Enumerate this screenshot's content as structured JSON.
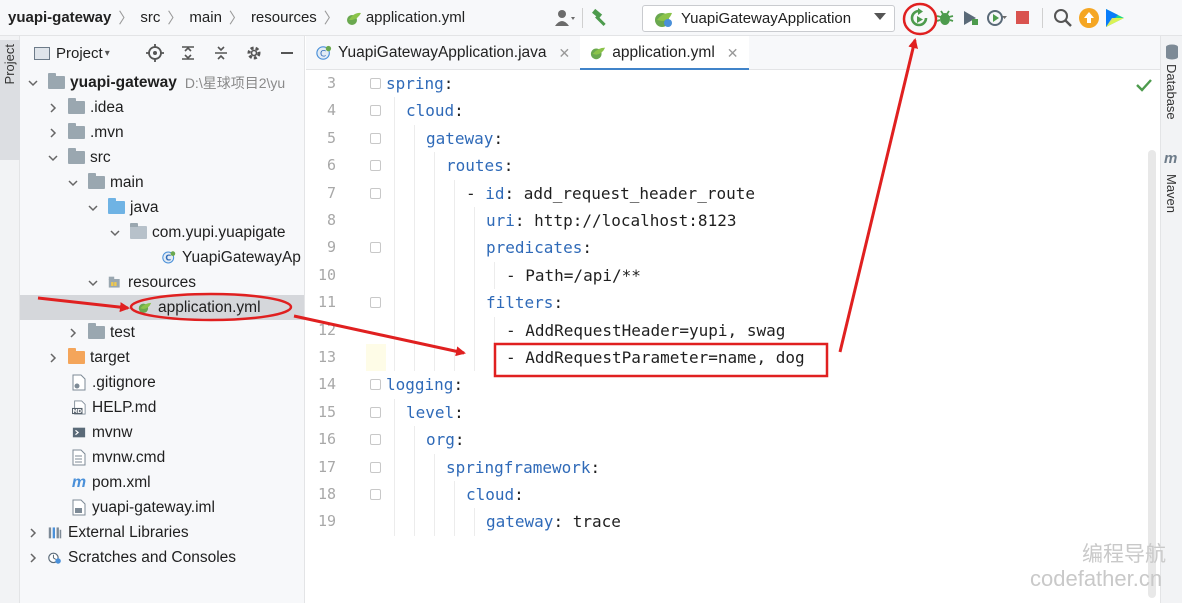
{
  "breadcrumb": {
    "items": [
      "yuapi-gateway",
      "src",
      "main",
      "resources",
      "application.yml"
    ]
  },
  "toolbar": {
    "run_config": "YuapiGatewayApplication",
    "icons": [
      "user-icon",
      "build-hammer-icon",
      "rerun-icon",
      "debug-icon",
      "coverage-icon",
      "profile-icon",
      "stop-icon",
      "search-icon",
      "update-icon",
      "jetbrains-toolbox-icon"
    ]
  },
  "left_stripe": {
    "label": "Project"
  },
  "project_panel": {
    "title": "Project",
    "tree": [
      {
        "label": "yuapi-gateway",
        "extra": "D:\\星球项目2\\yu",
        "type": "module",
        "bold": true
      },
      {
        "label": ".idea",
        "type": "folder"
      },
      {
        "label": ".mvn",
        "type": "folder"
      },
      {
        "label": "src",
        "type": "folder"
      },
      {
        "label": "main",
        "type": "folder"
      },
      {
        "label": "java",
        "type": "folder-blue"
      },
      {
        "label": "com.yupi.yuapigate",
        "type": "package"
      },
      {
        "label": "YuapiGatewayAp",
        "type": "spring-class"
      },
      {
        "label": "resources",
        "type": "resources"
      },
      {
        "label": "application.yml",
        "type": "yml",
        "selected": true
      },
      {
        "label": "test",
        "type": "folder"
      },
      {
        "label": "target",
        "type": "folder-orange"
      },
      {
        "label": ".gitignore",
        "type": "file"
      },
      {
        "label": "HELP.md",
        "type": "md"
      },
      {
        "label": "mvnw",
        "type": "file"
      },
      {
        "label": "mvnw.cmd",
        "type": "file"
      },
      {
        "label": "pom.xml",
        "type": "maven"
      },
      {
        "label": "yuapi-gateway.iml",
        "type": "file"
      },
      {
        "label": "External Libraries",
        "type": "libraries"
      },
      {
        "label": "Scratches and Consoles",
        "type": "scratches"
      }
    ]
  },
  "tabs": [
    {
      "label": "YuapiGatewayApplication.java",
      "active": false
    },
    {
      "label": "application.yml",
      "active": true
    }
  ],
  "editor": {
    "lines": [
      {
        "n": "3",
        "key": "spring",
        "rest": ":"
      },
      {
        "n": "4",
        "key": "cloud",
        "rest": ":"
      },
      {
        "n": "5",
        "key": "gateway",
        "rest": ":"
      },
      {
        "n": "6",
        "key": "routes",
        "rest": ":"
      },
      {
        "n": "7",
        "key": "id",
        "rest": ": add_request_header_route",
        "dash": "- "
      },
      {
        "n": "8",
        "key": "uri",
        "rest": ": http://localhost:8123"
      },
      {
        "n": "9",
        "key": "predicates",
        "rest": ":"
      },
      {
        "n": "10",
        "key": "",
        "rest": "- Path=/api/**"
      },
      {
        "n": "11",
        "key": "filters",
        "rest": ":"
      },
      {
        "n": "12",
        "key": "",
        "rest": "- AddRequestHeader=yupi, swag"
      },
      {
        "n": "13",
        "key": "",
        "rest": "- AddRequestParameter=name, dog"
      },
      {
        "n": "14",
        "key": "logging",
        "rest": ":"
      },
      {
        "n": "15",
        "key": "level",
        "rest": ":"
      },
      {
        "n": "16",
        "key": "org",
        "rest": ":"
      },
      {
        "n": "17",
        "key": "springframework",
        "rest": ":"
      },
      {
        "n": "18",
        "key": "cloud",
        "rest": ":"
      },
      {
        "n": "19",
        "key": "gateway",
        "rest": ": trace"
      }
    ]
  },
  "right_stripe": {
    "labels": [
      "Database",
      "Maven"
    ]
  },
  "watermark": {
    "line1": "编程导航",
    "line2": "codefather.cn"
  },
  "colors": {
    "annotation": "#e02020",
    "key": "#2f6ab8",
    "selection": "#d5d7db",
    "tab_underline": "#4083c9"
  }
}
